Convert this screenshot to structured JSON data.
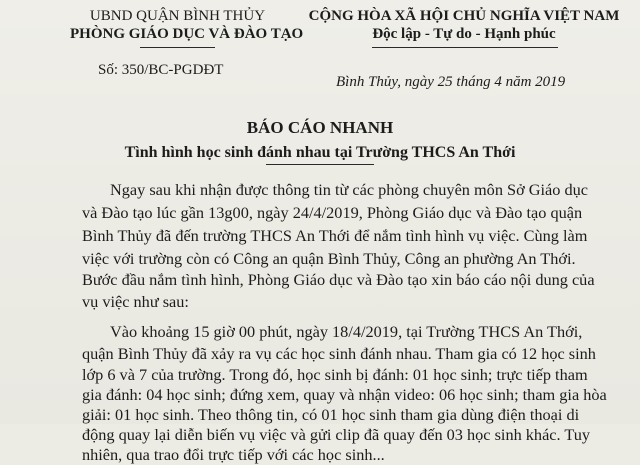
{
  "header_left": {
    "authority": "UBND QUẬN BÌNH THỦY",
    "department": "PHÒNG GIÁO DỤC VÀ ĐÀO TẠO",
    "doc_number": "Số: 350/BC-PGDĐT"
  },
  "header_right": {
    "nation": "CỘNG HÒA XÃ HỘI CHỦ NGHĨA VIỆT NAM",
    "motto": "Độc lập - Tự do - Hạnh phúc",
    "place_date": "Bình Thủy, ngày 25 tháng 4 năm 2019"
  },
  "title": "BÁO CÁO NHANH",
  "subtitle": "Tình hình học sinh đánh nhau tại Trường THCS An Thới",
  "body_lines": [
    "Ngay sau khi nhận được thông tin từ các phòng chuyên môn Sở Giáo dục",
    "và Đào tạo lúc gần 13g00, ngày 24/4/2019, Phòng Giáo dục và Đào tạo quận",
    "Bình Thủy đã đến trường THCS An Thới để nắm tình hình vụ việc. Cùng làm",
    "việc với trường còn có Công an quận Bình Thủy, Công an phường An Thới.",
    "Bước đầu nắm tình hình, Phòng Giáo dục và Đào tạo xin báo cáo nội dung của",
    "vụ việc như sau:",
    "Vào khoảng 15 giờ 00 phút, ngày 18/4/2019, tại Trường THCS An Thới,",
    "quận Bình Thủy đã xảy ra vụ các học sinh đánh nhau. Tham gia có 12 học sinh",
    "lớp 6 và 7 của trường. Trong đó, học sinh bị đánh: 01 học sinh; trực tiếp tham",
    "gia đánh: 04 học sinh; đứng xem, quay và nhận video: 06 học sinh; tham gia hòa",
    "giải: 01 học sinh. Theo thông tin, có 01 học sinh tham gia dùng điện thoại di",
    "động quay lại diễn biến vụ việc và gửi clip đã quay đến 03 học sinh khác. Tuy",
    "nhiên, qua trao đổi trực tiếp với các học sinh..."
  ]
}
